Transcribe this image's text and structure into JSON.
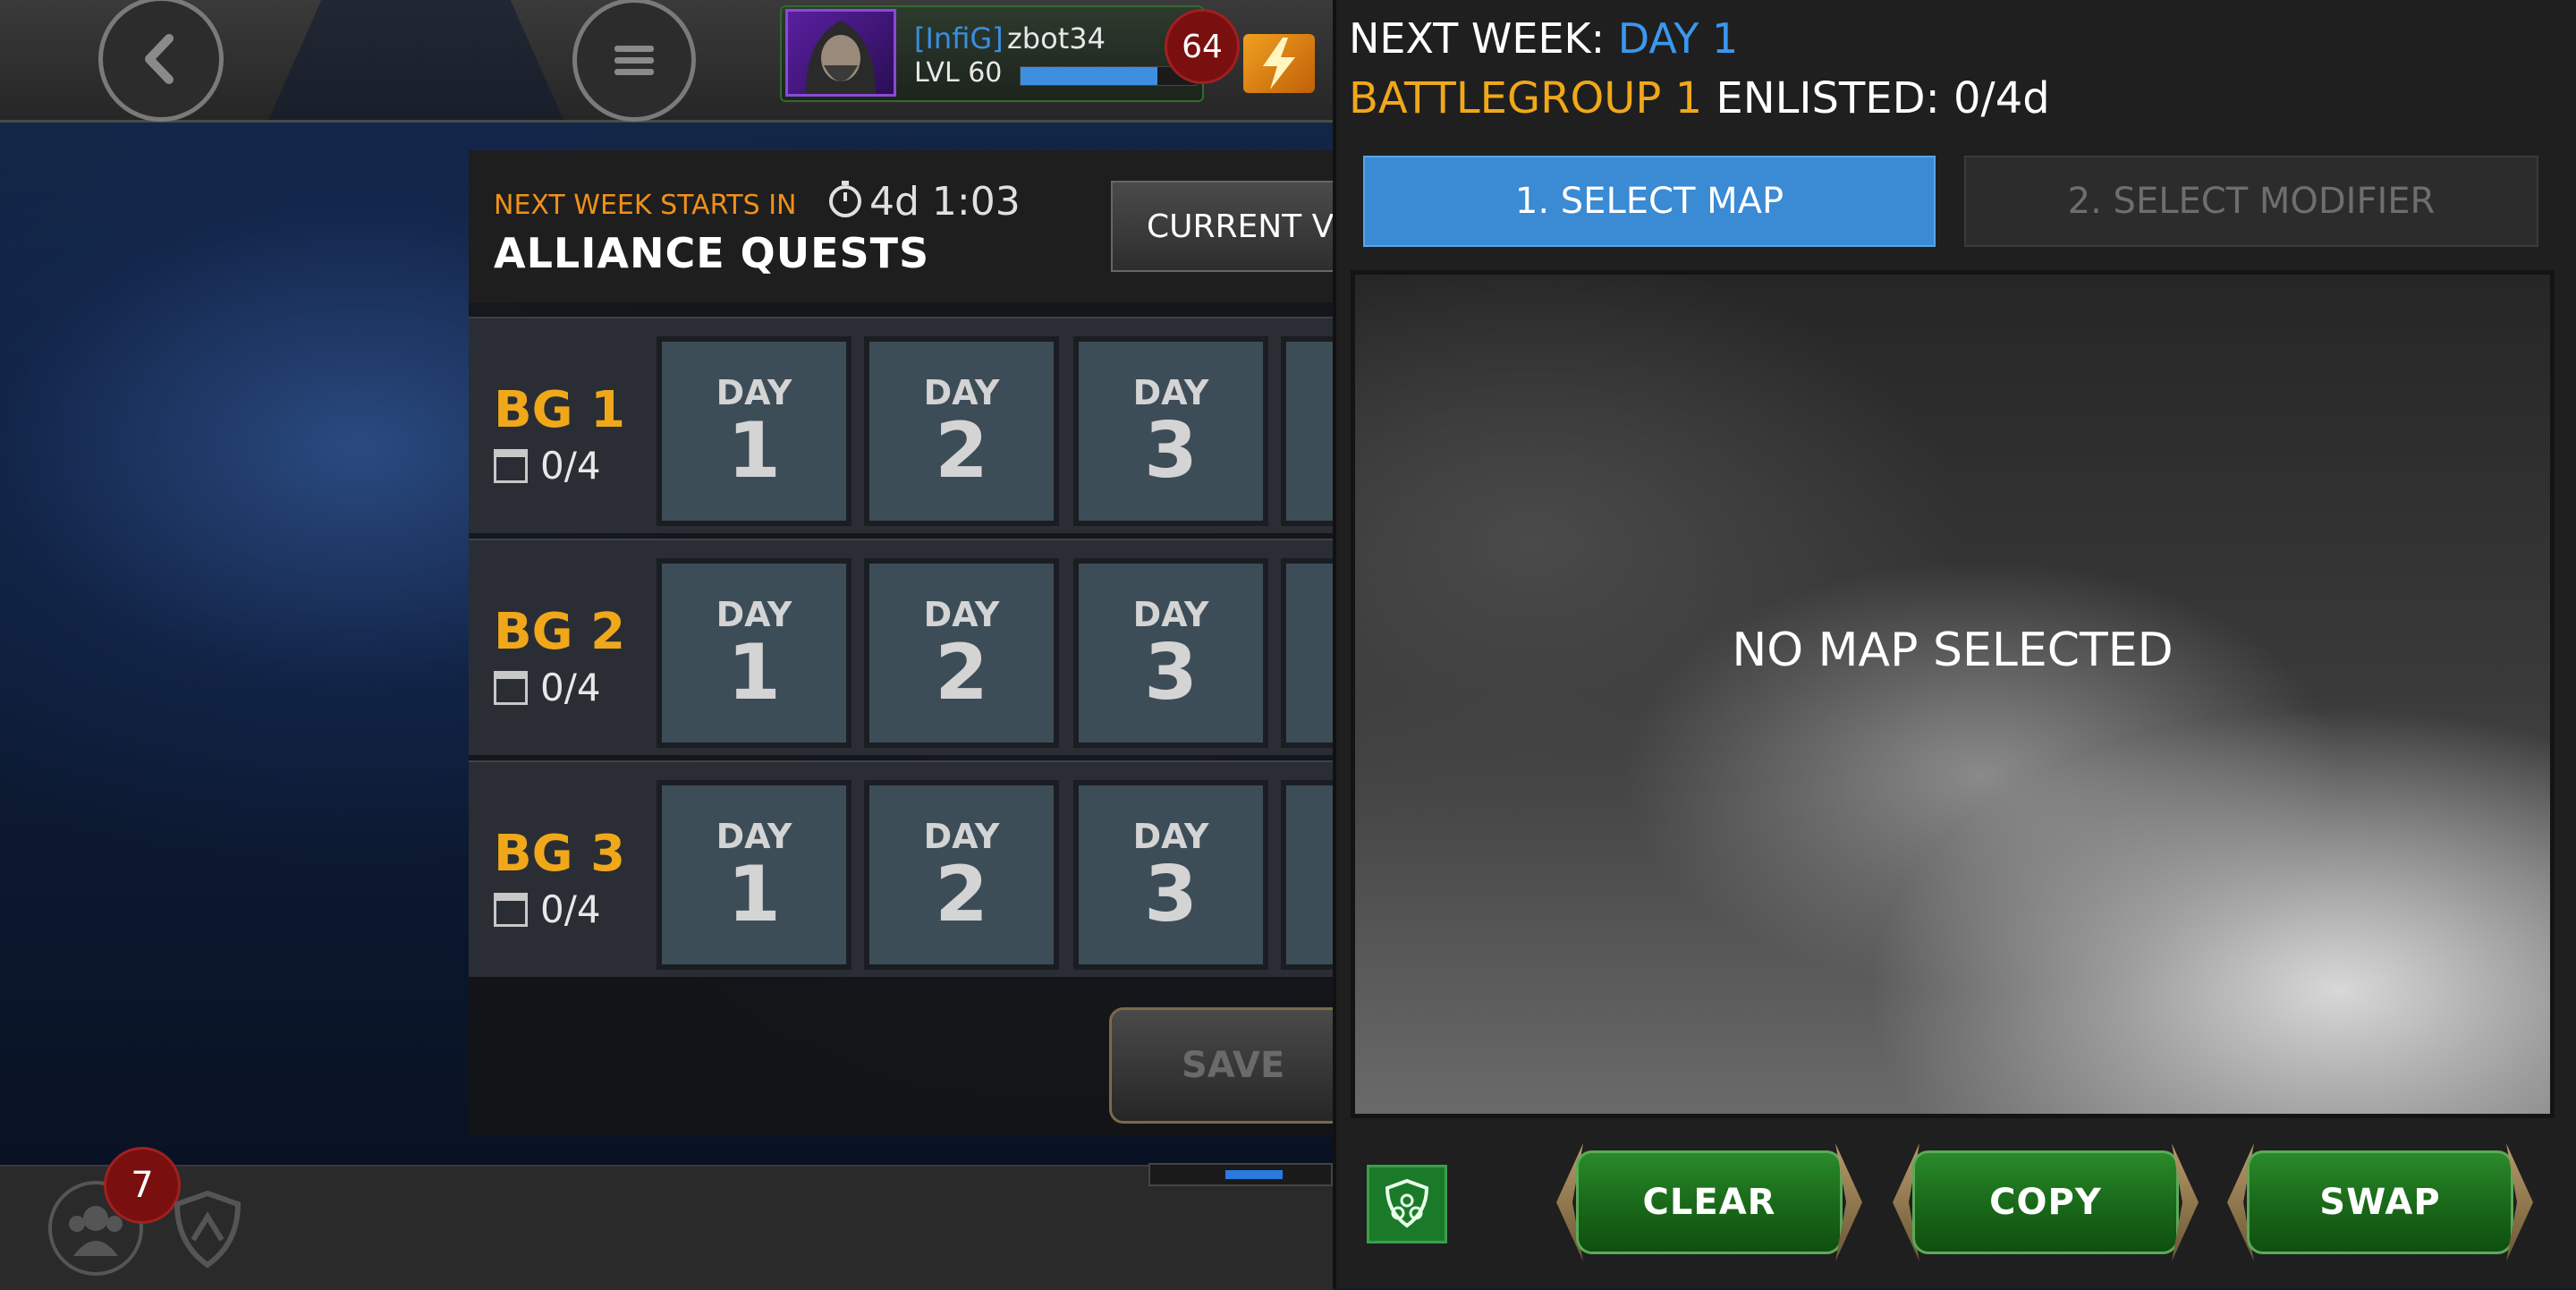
{
  "header": {
    "profile": {
      "tag": "[InfiG]",
      "username": "zbot34",
      "level_label": "LVL 60",
      "xp_fraction": 0.78
    },
    "notification_count": "64"
  },
  "main": {
    "next_week_label": "NEXT WEEK STARTS IN",
    "timer": "4d 1:03",
    "title": "ALLIANCE QUESTS",
    "current_button": "CURRENT V",
    "save_button": "SAVE",
    "battlegroups": [
      {
        "label": "BG 1",
        "enlisted": "0/4",
        "days": [
          {
            "word": "DAY",
            "num": "1"
          },
          {
            "word": "DAY",
            "num": "2"
          },
          {
            "word": "DAY",
            "num": "3"
          }
        ]
      },
      {
        "label": "BG 2",
        "enlisted": "0/4",
        "days": [
          {
            "word": "DAY",
            "num": "1"
          },
          {
            "word": "DAY",
            "num": "2"
          },
          {
            "word": "DAY",
            "num": "3"
          }
        ]
      },
      {
        "label": "BG 3",
        "enlisted": "0/4",
        "days": [
          {
            "word": "DAY",
            "num": "1"
          },
          {
            "word": "DAY",
            "num": "2"
          },
          {
            "word": "DAY",
            "num": "3"
          }
        ]
      }
    ]
  },
  "bottom": {
    "alliance_badge": "7"
  },
  "right_panel": {
    "next_week_prefix": "NEXT WEEK: ",
    "next_week_day": "DAY 1",
    "battlegroup_name": "BATTLEGROUP 1",
    "enlisted_text": " ENLISTED: 0/4d",
    "tab_select_map": "1. SELECT MAP",
    "tab_select_modifier": "2. SELECT MODIFIER",
    "no_map": "NO MAP SELECTED",
    "buttons": {
      "clear": "CLEAR",
      "copy": "COPY",
      "swap": "SWAP"
    }
  },
  "colors": {
    "accent_blue": "#3a8ad4",
    "bg_label_orange": "#f0a81a",
    "button_green": "#1a6a1a"
  }
}
